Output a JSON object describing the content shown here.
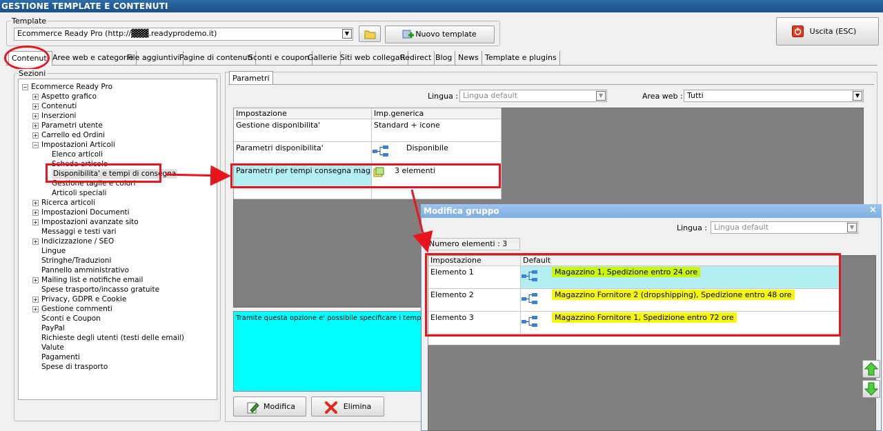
{
  "app": {
    "title": "GESTIONE TEMPLATE E CONTENUTI"
  },
  "template": {
    "label": "Template",
    "value": "Ecommerce Ready Pro (http://▓▓▓.readyprodemo.it)",
    "new_button": "Nuovo template",
    "exit_button": "Uscita (ESC)"
  },
  "tabs": [
    "Contenuti",
    "Aree web e categorie",
    "File aggiuntivi",
    "Pagine di contenuti",
    "Sconti e coupon",
    "Gallerie",
    "Siti web collegati",
    "Redirect",
    "Blog",
    "News",
    "Template e plugins"
  ],
  "sections": {
    "label": "Sezioni",
    "root": "Ecommerce Ready Pro",
    "items": [
      {
        "label": "Aspetto grafico",
        "level": 1,
        "exp": "+"
      },
      {
        "label": "Contenuti",
        "level": 1,
        "exp": "+"
      },
      {
        "label": "Inserzioni",
        "level": 1,
        "exp": "+"
      },
      {
        "label": "Parametri utente",
        "level": 1,
        "exp": "+"
      },
      {
        "label": "Carrello ed Ordini",
        "level": 1,
        "exp": "+"
      },
      {
        "label": "Impostazioni Articoli",
        "level": 1,
        "exp": "-"
      },
      {
        "label": "Elenco articoli",
        "level": 2,
        "exp": ""
      },
      {
        "label": "Scheda articolo",
        "level": 2,
        "exp": ""
      },
      {
        "label": "Disponibilita' e tempi di consegna",
        "level": 2,
        "exp": "",
        "selected": true
      },
      {
        "label": "Gestione taglie e colori",
        "level": 2,
        "exp": ""
      },
      {
        "label": "Articoli speciali",
        "level": 2,
        "exp": ""
      },
      {
        "label": "Ricerca articoli",
        "level": 1,
        "exp": "+"
      },
      {
        "label": "Impostazioni Documenti",
        "level": 1,
        "exp": "+"
      },
      {
        "label": "Impostazioni avanzate sito",
        "level": 1,
        "exp": "+"
      },
      {
        "label": "Messaggi e testi vari",
        "level": 1,
        "exp": ""
      },
      {
        "label": "Indicizzazione / SEO",
        "level": 1,
        "exp": "+"
      },
      {
        "label": "Lingue",
        "level": 1,
        "exp": ""
      },
      {
        "label": "Stringhe/Traduzioni",
        "level": 1,
        "exp": ""
      },
      {
        "label": "Pannello amministrativo",
        "level": 1,
        "exp": ""
      },
      {
        "label": "Mailing list e notifiche email",
        "level": 1,
        "exp": "+"
      },
      {
        "label": "Spese trasporto/incasso gratuite",
        "level": 1,
        "exp": ""
      },
      {
        "label": "Privacy, GDPR e Cookie",
        "level": 1,
        "exp": "+"
      },
      {
        "label": "Gestione commenti",
        "level": 1,
        "exp": "+"
      },
      {
        "label": "Sconti e Coupon",
        "level": 1,
        "exp": ""
      },
      {
        "label": "PayPal",
        "level": 1,
        "exp": ""
      },
      {
        "label": "Richieste degli utenti (testi delle email)",
        "level": 1,
        "exp": ""
      },
      {
        "label": "Valute",
        "level": 1,
        "exp": ""
      },
      {
        "label": "Pagamenti",
        "level": 1,
        "exp": ""
      },
      {
        "label": "Spese di trasporto",
        "level": 1,
        "exp": ""
      }
    ]
  },
  "params": {
    "tab": "Parametri",
    "lingua_label": "Lingua :",
    "lingua_value": "Lingua default",
    "area_label": "Area web :",
    "area_value": "Tutti",
    "col_setting": "Impostazione",
    "col_value": "Imp.generica",
    "rows": [
      {
        "setting": "Gestione disponibilita'",
        "value": "Standard + icone"
      },
      {
        "setting": "Parametri disponibilita'",
        "value": "Disponibile"
      },
      {
        "setting": "Parametri per tempi consegna magazzini",
        "value": "3 elementi"
      }
    ],
    "description": "Tramite questa opzione e' possibile specificare i tempi di cons",
    "modifica": "Modifica",
    "elimina": "Elimina"
  },
  "dialog": {
    "title": "Modifica gruppo",
    "close": "×",
    "lingua_label": "Lingua :",
    "lingua_value": "Lingua default",
    "count": "Numero elementi : 3",
    "col_setting": "Impostazione",
    "col_value": "Default",
    "rows": [
      {
        "setting": "Elemento 1",
        "value": "Magazzino 1, Spedizione entro 24 ore"
      },
      {
        "setting": "Elemento 2",
        "value": "Magazzino Fornitore 2 (dropshipping), Spedizione entro 48 ore"
      },
      {
        "setting": "Elemento 3",
        "value": "Magazzino Fornitore 1, Spedizione entro 72 ore"
      }
    ]
  }
}
